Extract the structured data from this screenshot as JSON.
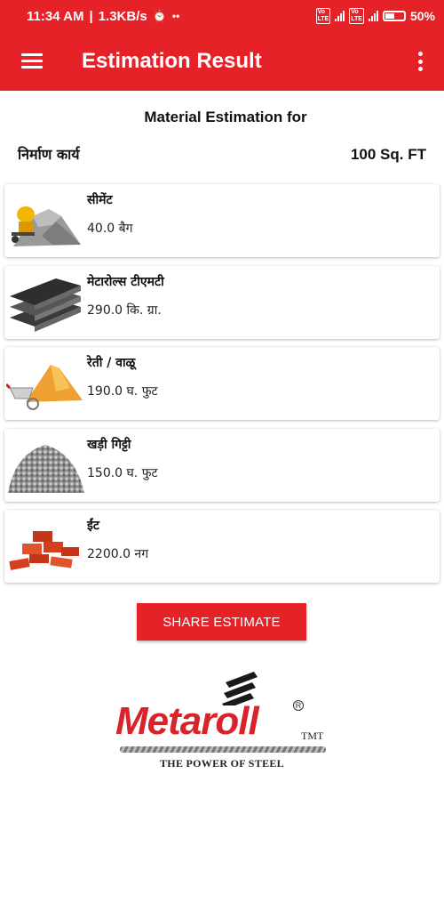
{
  "status_bar": {
    "time": "11:34 AM",
    "net_speed": "1.3KB/s",
    "battery": "50%"
  },
  "app_bar": {
    "title": "Estimation Result",
    "menu_icon": "hamburger-menu-icon",
    "more_icon": "more-vertical-icon"
  },
  "summary": {
    "heading": "Material Estimation for",
    "work_label": "निर्माण कार्य",
    "area": "100 Sq. FT"
  },
  "materials": [
    {
      "name": "सीमेंट",
      "quantity": "40.0 बैग",
      "icon": "cement-icon"
    },
    {
      "name": "मेटारोल्स टीएमटी",
      "quantity": "290.0 कि. ग्रा.",
      "icon": "tmt-steel-bars-icon"
    },
    {
      "name": "रेती / वाळू",
      "quantity": "190.0 घ. फुट",
      "icon": "sand-icon"
    },
    {
      "name": "खड़ी गिट्टी",
      "quantity": "150.0 घ. फुट",
      "icon": "gravel-icon"
    },
    {
      "name": "ईंट",
      "quantity": "2200.0 नग",
      "icon": "bricks-icon"
    }
  ],
  "share_button": "SHARE ESTIMATE",
  "logo": {
    "brand": "Metaroll",
    "reg": "R",
    "tmt": "TMT",
    "tagline": "THE POWER OF STEEL"
  },
  "colors": {
    "accent": "#e52228",
    "background": "#ffffff"
  }
}
